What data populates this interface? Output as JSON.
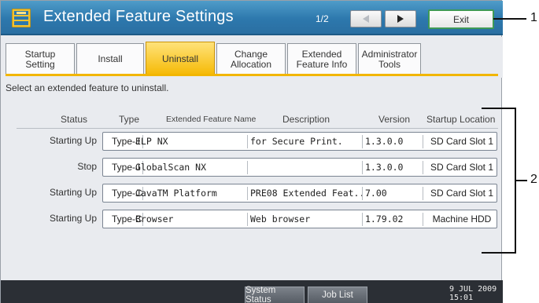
{
  "titlebar": {
    "title": "Extended Feature Settings",
    "page_indicator": "1/2",
    "exit_label": "Exit"
  },
  "tabs": [
    {
      "label": "Startup\nSetting",
      "active": false
    },
    {
      "label": "Install",
      "active": false
    },
    {
      "label": "Uninstall",
      "active": true
    },
    {
      "label": "Change\nAllocation",
      "active": false
    },
    {
      "label": "Extended\nFeature Info",
      "active": false
    },
    {
      "label": "Administrator\nTools",
      "active": false
    }
  ],
  "instruction": "Select an extended feature to uninstall.",
  "table": {
    "headers": {
      "status": "Status",
      "type": "Type",
      "name": "Extended Feature Name",
      "description": "Description",
      "version": "Version",
      "location": "Startup Location"
    },
    "rows": [
      {
        "status": "Starting Up",
        "type": "Type-J",
        "name": "ELP NX",
        "description": "for Secure Print.",
        "version": "1.3.0.0",
        "location": "SD Card Slot 1"
      },
      {
        "status": "Stop",
        "type": "Type-J",
        "name": "GlobalScan NX",
        "description": "",
        "version": "1.3.0.0",
        "location": "SD Card Slot 1"
      },
      {
        "status": "Starting Up",
        "type": "Type-C",
        "name": "JavaTM Platform",
        "description": "PRE08 Extended Feat...",
        "version": "7.00",
        "location": "SD Card Slot 1"
      },
      {
        "status": "Starting Up",
        "type": "Type-C",
        "name": "Browser",
        "description": "Web browser",
        "version": "1.79.02",
        "location": "Machine HDD"
      }
    ]
  },
  "footer": {
    "system_status": "System Status",
    "job_list": "Job List",
    "date": "9 JUL  2009",
    "time": "15:01"
  },
  "callouts": {
    "one": "1",
    "two": "2"
  },
  "colors": {
    "titlebar": "#2d78ad",
    "active_tab": "#f5b800",
    "exit_border": "#3f9a55",
    "footer": "#2b2f35"
  }
}
